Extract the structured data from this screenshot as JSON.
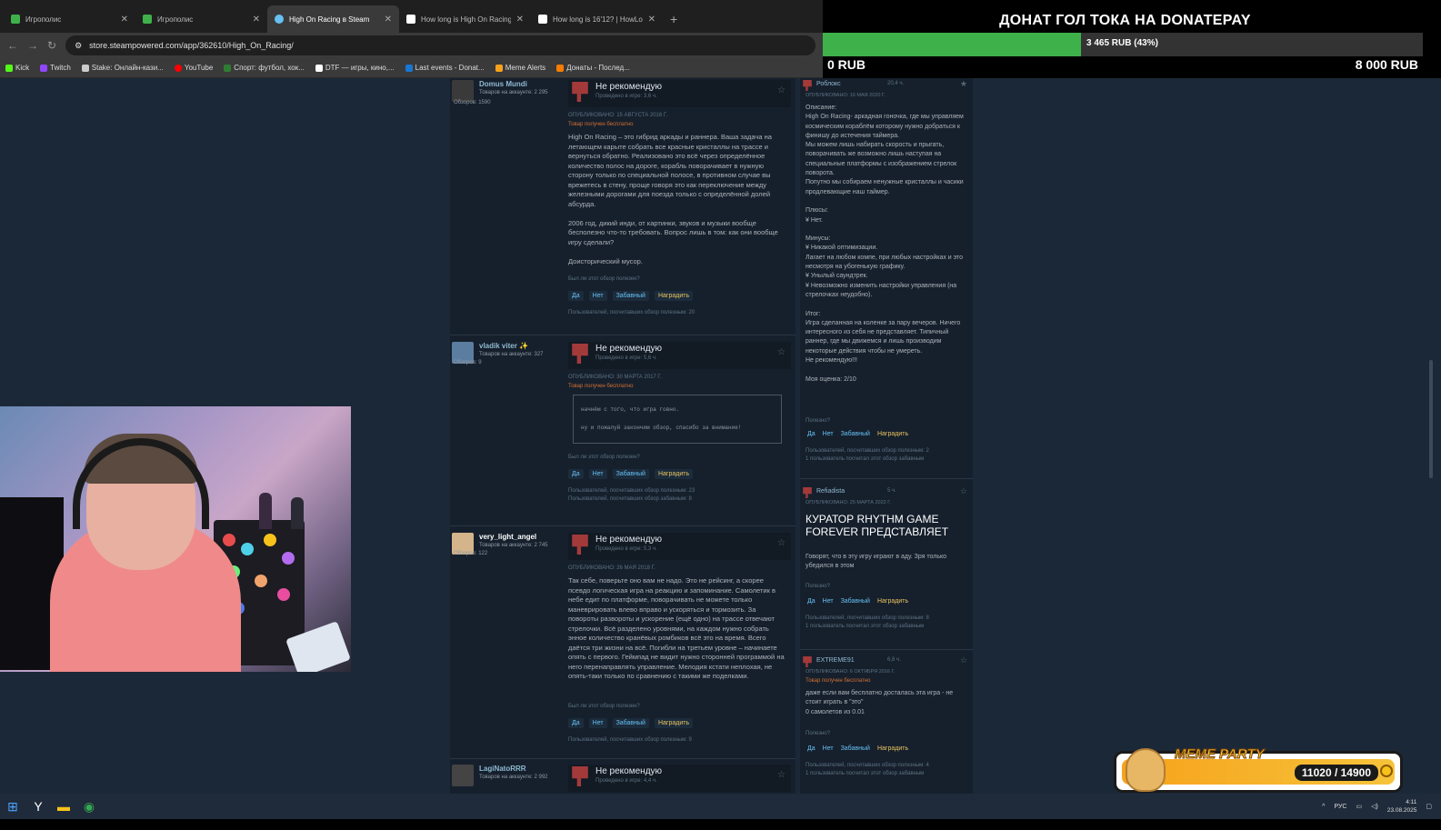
{
  "browser": {
    "tabs": [
      {
        "label": "Игрополис",
        "color": "#3fb14a",
        "active": false
      },
      {
        "label": "Игрополис",
        "color": "#3fb14a",
        "active": false
      },
      {
        "label": "High On Racing в Steam",
        "color": "#66c0f4",
        "active": true
      },
      {
        "label": "How long is High On Racing? |",
        "color": "#222222",
        "active": false
      },
      {
        "label": "How long is 16'12? | HowLong",
        "color": "#222222",
        "active": false
      }
    ],
    "new_tab": "+",
    "url": "store.steampowered.com/app/362610/High_On_Racing/",
    "bookmarks": [
      {
        "label": "Kick",
        "color": "#53fc18"
      },
      {
        "label": "Twitch",
        "color": "#9146ff"
      },
      {
        "label": "Stake: Онлайн-кази...",
        "color": "#cccccc"
      },
      {
        "label": "YouTube",
        "color": "#ff0000"
      },
      {
        "label": "Спорт: футбол, хок...",
        "color": "#2e7d32"
      },
      {
        "label": "DTF — игры, кино,...",
        "color": "#ffffff"
      },
      {
        "label": "Last events - Donat...",
        "color": "#1976d2"
      },
      {
        "label": "Meme Alerts",
        "color": "#f7a21b"
      },
      {
        "label": "Донаты - Послед...",
        "color": "#f57c00"
      }
    ]
  },
  "donate": {
    "title": "ДОНАТ ГОЛ ТОКА НА DONATEPAY",
    "progress_text": "3 465 RUB (43%)",
    "progress": 0.43,
    "min": "0 RUB",
    "max": "8 000 RUB"
  },
  "reviews_left": [
    {
      "author": "Domus Mundi",
      "products": "Товаров на аккаунте: 2 295",
      "reviews": "Обзоров: 1590",
      "verdict": "Не рекомендую",
      "hours": "Проведено в игре: 3,6 ч.",
      "posted": "Опубликовано: 15 августа 2016 г.",
      "free": "Товар получен бесплатно",
      "body": "High On Racing – это гибрид аркады и раннера. Ваша задача на летающем карыте собрать все красные кристаллы на трассе и вернуться обратно. Реализовано это всё через определённое количество полос на дороге, корабль поворачивает в нужную сторону только по специальной полосе, в противном случае вы врежетесь в стену, проще говоря это как переключение между железными дорогами для поезда только с определённой долей абсурда.\n\n2006 год, дикий инди, от картинки, звуков и музыки вообще бесполезно что-то требовать. Вопрос лишь в том: как они вообще игру сделали?\n\nДоисторический мусор.",
      "helpq": "Был ли этот обзор полезен?",
      "helpful": "Пользователей, посчитавших обзор полезным: 20"
    },
    {
      "author": "vladik viter ✨",
      "products": "Товаров на аккаунте: 327",
      "reviews": "Обзоров: 9",
      "verdict": "Не рекомендую",
      "hours": "Проведено в игре: 5,6 ч.",
      "posted": "Опубликовано: 30 марта 2017 г.",
      "free": "Товар получен бесплатно",
      "quote1": "начнём с того, что игра говно.",
      "quote2": "ну и пожалуй закончим обзор, спасибо за внимание!",
      "helpq": "Был ли этот обзор полезен?",
      "helpful": "Пользователей, посчитавших обзор полезным: 23\nПользователей, посчитавших обзор забавным: 8"
    },
    {
      "author": "very_light_angel",
      "products": "Товаров на аккаунте: 2 745",
      "reviews": "Обзоров: 122",
      "verdict": "Не рекомендую",
      "hours": "Проведено в игре: 5,3 ч.",
      "posted": "Опубликовано: 26 мая 2018 г.",
      "body": "Так себе, поверьте оно вам не надо. Это не рейсинг, а скорее псевдо логическая игра на реакцию и запоминание. Самолетик в небе едит по платформе, поворачивать не можете только маневрировать влево вправо и ускоряться и тормозить. За повороты развороты и ускорение (ещё одно) на трассе отвечают стрелочки. Всё разделено уровнями, на каждом нужно собрать энное количество кранёвых ромбиков всё это на время. Всего даётся три жизни на всё. Погибли на третьем уровне – начинаете опять с первого. Геймпад не видит нужно сторонней программой на него перенаправлять управление. Мелодия кстати неплохая, не опять-таки только по сравнению с такими же поделками.",
      "helpq": "Был ли этот обзор полезен?",
      "helpful": "Пользователей, посчитавших обзор полезным: 9"
    },
    {
      "author": "LagiNatoRRR",
      "products": "Товаров на аккаунте: 2 992",
      "verdict": "Не рекомендую",
      "hours": "Проведено в игре: 4,4 ч."
    }
  ],
  "review_buttons": {
    "yes": "Да",
    "no": "Нет",
    "funny": "Забавный",
    "award": "Наградить"
  },
  "reviews_right": [
    {
      "author": "Роблокс",
      "hours": "20,4 ч.",
      "posted": "Опубликовано: 16 мая 2020 г.",
      "body": "Описание:\nHigh On Racing- аркадная гоночка, где мы управляем космическим кораблём которому нужно добраться к финишу до истечения таймера.\nМы можем лишь набирать скорость и прыгать, поворачивать же возможно лишь наступая на специальные платформы с изображением стрелок поворота.\nПопутно мы собираем ненужные кристаллы и часики продлевающие наш таймер.\n\nПлюсы:\n¥ Нет.\n\nМинусы:\n¥ Никакой оптимизации.\nЛагает на любом компе, при любых настройках и это несмотря на убогенькую графику.\n¥ Унылый саундтрек.\n¥ Невозможно изменить настройки управления (на стрелочках неудобно).\n\nИтог:\nИгра сделанная на коленке за пару вечеров. Ничего интересного из себя не представляет. Типичный раннер, где мы движемся и лишь производим некоторые действия чтобы не умереть.\nНе рекомендую!!!\n\nМоя оценка: 2/10",
      "helpq": "Полезно?",
      "helpful": "Пользователей, посчитавших обзор полезным: 2\n1 пользователь посчитал этот обзор забавным"
    },
    {
      "author": "Refiadista",
      "hours": "5 ч.",
      "posted": "Опубликовано: 25 марта 2022 г.",
      "curator": "КУРАТОР RHYTHM GAME FOREVER ПРЕДСТАВЛЯЕТ",
      "body": "Говорят, что в эту игру играют в аду. Зря только убедился в этом",
      "helpq": "Полезно?",
      "helpful": "Пользователей, посчитавших обзор полезным: 8\n1 пользователь посчитал этот обзор забавным"
    },
    {
      "author": "EXTREME91",
      "hours": "6,8 ч.",
      "posted": "Опубликовано: 6 октября 2016 г.",
      "free": "Товар получен бесплатно",
      "body": "даже если вам бесплатно досталась эта игра - не стоит играть в \"это\"\n0 самолетов из 0.01",
      "helpq": "Полезно?",
      "helpful": "Пользователей, посчитавших обзор полезным: 4\n1 пользователь посчитал этот обзор забавным"
    }
  ],
  "meme_party": {
    "label": "MEME PARTY",
    "count": "11020 / 14900"
  },
  "taskbar": {
    "lang": "РУС",
    "time": "4:11",
    "date": "23.08.2025"
  }
}
